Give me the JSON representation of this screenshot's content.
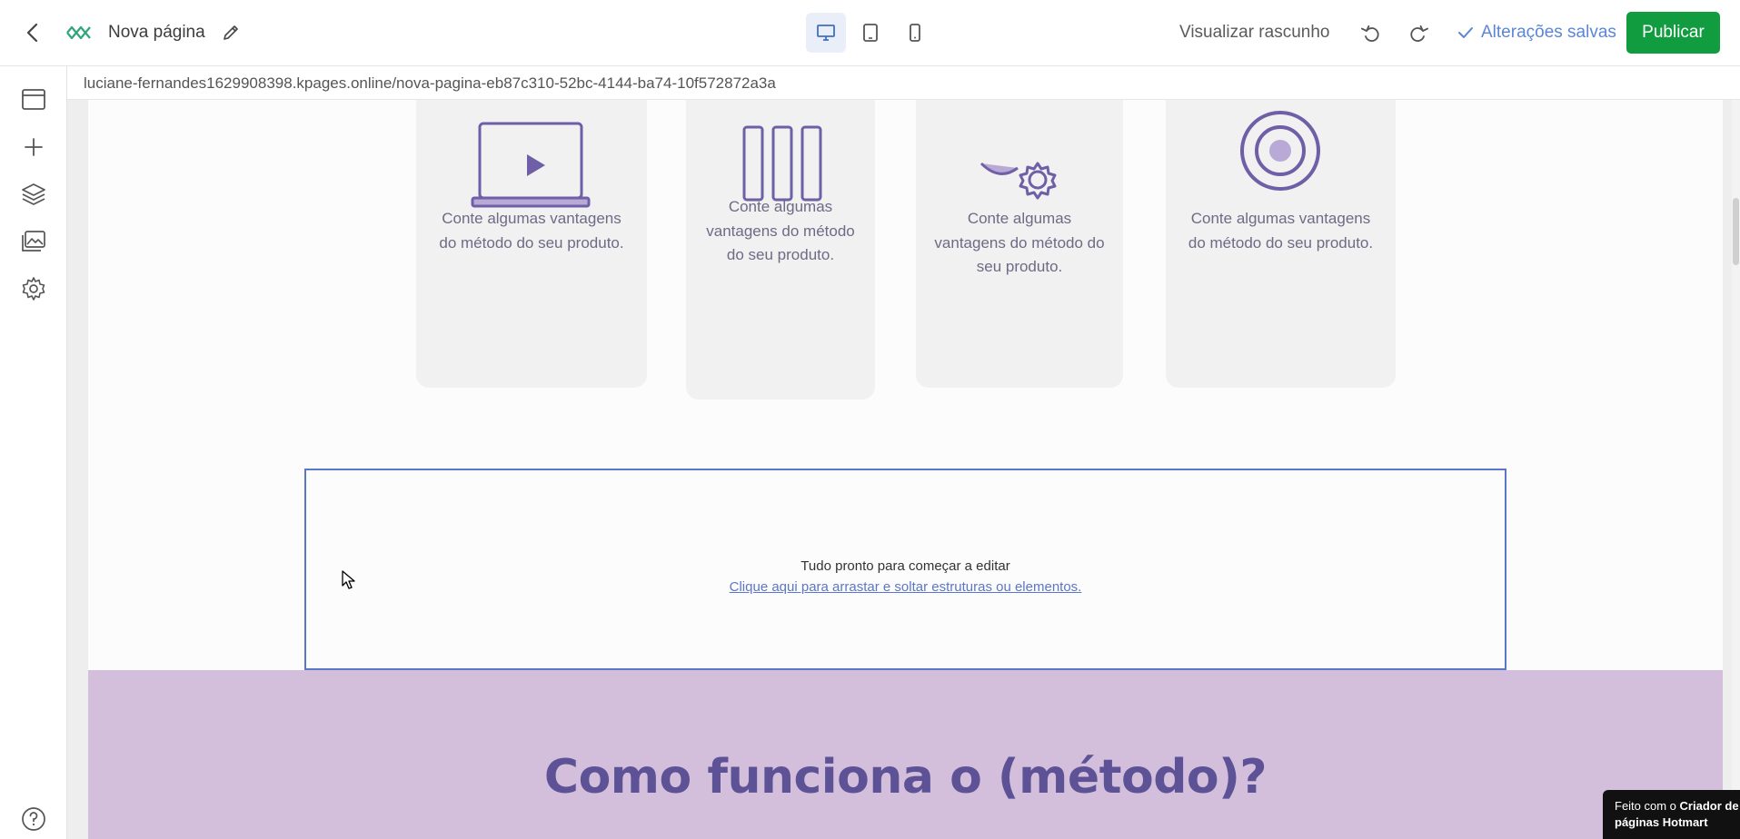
{
  "topbar": {
    "page_name": "Nova página",
    "preview_label": "Visualizar rascunho",
    "saved_label": "Alterações salvas",
    "publish_label": "Publicar",
    "active_device": "desktop",
    "devices": [
      "desktop-icon",
      "tablet-icon",
      "mobile-icon"
    ]
  },
  "sidebar": {
    "items": [
      "browser-window-icon",
      "plus-icon",
      "layers-icon",
      "gallery-icon",
      "gear-icon"
    ],
    "help_icon": "help-circle-icon"
  },
  "url": "luciane-fernandes1629908398.kpages.online/nova-pagina-eb87c310-52bc-4144-ba74-10f572872a3a",
  "cards": [
    {
      "icon": "video-laptop-icon",
      "text": "Conte algumas vantagens do método do seu produto."
    },
    {
      "icon": "bar-chart-icon",
      "text": "Conte algumas vantagens do método do seu produto."
    },
    {
      "icon": "gears-icon",
      "text": "Conte algumas vantagens do método do seu produto."
    },
    {
      "icon": "target-icon",
      "text": "Conte algumas vantagens do método do seu produto."
    }
  ],
  "dropzone": {
    "title": "Tudo pronto para começar a editar",
    "link": "Clique aqui para arrastar e soltar estruturas ou elementos."
  },
  "section_title": "Como funciona o (método)?",
  "badge": {
    "prefix": "Feito com o ",
    "strong1": "Criador de",
    "strong2": "páginas Hotmart"
  },
  "colors": {
    "accent_blue": "#5b86d6",
    "publish_green": "#119c40",
    "purple_section": "#d3bfdc",
    "title_purple": "#5d5296",
    "icon_purple": "#6e5fa6"
  }
}
